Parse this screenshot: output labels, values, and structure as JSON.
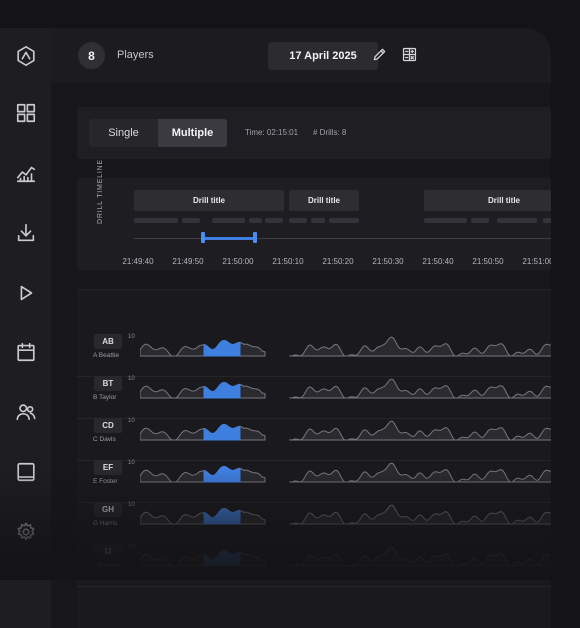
{
  "sidebar": {
    "items": [
      {
        "icon": "app-logo-icon"
      },
      {
        "icon": "dashboard-icon"
      },
      {
        "icon": "analytics-chart-icon"
      },
      {
        "icon": "download-icon"
      },
      {
        "icon": "play-icon"
      },
      {
        "icon": "calendar-icon"
      },
      {
        "icon": "users-icon"
      },
      {
        "icon": "tablet-icon"
      },
      {
        "icon": "gear-icon"
      }
    ]
  },
  "topbar": {
    "player_count": "8",
    "players_label": "Players",
    "date": "17 April 2025",
    "edit_icon": "pencil-icon",
    "calc_icon": "calculator-icon"
  },
  "mode": {
    "single_label": "Single",
    "multiple_label": "Multiple",
    "selected": "Multiple",
    "time_text": "Time: 02:15:01",
    "drills_text": "# Drills: 8"
  },
  "timeline": {
    "label": "DRILL TIMELINE",
    "drills": [
      "Drill title",
      "Drill title",
      "Drill title"
    ],
    "times": [
      "21:49:40",
      "21:49:50",
      "21:50:00",
      "21:50:10",
      "21:50:20",
      "21:50:30",
      "21:50:40",
      "21:50:50",
      "21:51:00"
    ],
    "accent_color": "#3f7fe0"
  },
  "players": [
    {
      "initials": "AB",
      "name": "A Beattie",
      "scale": "10"
    },
    {
      "initials": "BT",
      "name": "B Taylor",
      "scale": "10"
    },
    {
      "initials": "CD",
      "name": "C Davis",
      "scale": "10"
    },
    {
      "initials": "EF",
      "name": "E Foster",
      "scale": "10"
    },
    {
      "initials": "GH",
      "name": "G Harris",
      "scale": "10"
    },
    {
      "initials": "IJ",
      "name": "I Johnson",
      "scale": "10"
    }
  ]
}
